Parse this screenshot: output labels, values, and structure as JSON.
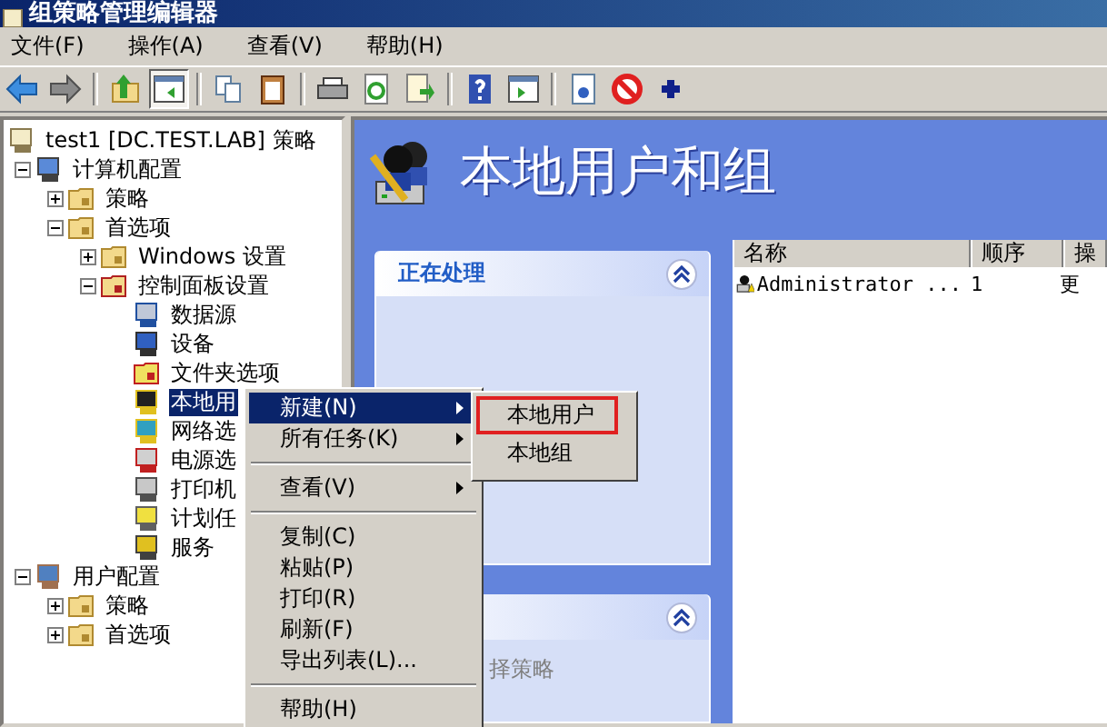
{
  "window": {
    "title": "组策略管理编辑器"
  },
  "menu_bar": [
    "文件(F)",
    "操作(A)",
    "查看(V)",
    "帮助(H)"
  ],
  "toolbar": [
    {
      "kind": "back",
      "pressed": false
    },
    {
      "kind": "forward",
      "pressed": false
    },
    {
      "kind": "separator"
    },
    {
      "kind": "up",
      "pressed": false
    },
    {
      "kind": "tree",
      "pressed": true
    },
    {
      "kind": "separator"
    },
    {
      "kind": "copy",
      "pressed": false
    },
    {
      "kind": "paste",
      "pressed": false
    },
    {
      "kind": "separator"
    },
    {
      "kind": "print",
      "pressed": false
    },
    {
      "kind": "refresh",
      "pressed": false
    },
    {
      "kind": "export",
      "pressed": false
    },
    {
      "kind": "separator"
    },
    {
      "kind": "help",
      "pressed": false
    },
    {
      "kind": "pane",
      "pressed": false
    },
    {
      "kind": "separator"
    },
    {
      "kind": "properties",
      "pressed": false
    },
    {
      "kind": "stop",
      "pressed": false
    },
    {
      "kind": "add",
      "pressed": false
    }
  ],
  "tree": {
    "label": "test1 [DC.TEST.LAB] 策略",
    "kind": "scroll",
    "selected": false,
    "children": [
      {
        "label": "计算机配置",
        "kind": "computer",
        "expanded": true,
        "selected": false,
        "children": [
          {
            "label": "策略",
            "kind": "folder",
            "expanded": false,
            "selected": false
          },
          {
            "label": "首选项",
            "kind": "folder",
            "expanded": true,
            "selected": false,
            "children": [
              {
                "label": "Windows 设置",
                "kind": "folder",
                "expanded": false,
                "selected": false
              },
              {
                "label": "控制面板设置",
                "kind": "control-panel",
                "expanded": true,
                "selected": false,
                "children": [
                  {
                    "label": "数据源",
                    "kind": "datasource",
                    "selected": false
                  },
                  {
                    "label": "设备",
                    "kind": "device",
                    "selected": false
                  },
                  {
                    "label": "文件夹选项",
                    "kind": "folder-options",
                    "selected": false
                  },
                  {
                    "label": "本地用",
                    "kind": "users",
                    "selected": true
                  },
                  {
                    "label": "网络选",
                    "kind": "network",
                    "selected": false
                  },
                  {
                    "label": "电源选",
                    "kind": "power",
                    "selected": false
                  },
                  {
                    "label": "打印机",
                    "kind": "printer",
                    "selected": false
                  },
                  {
                    "label": "计划任",
                    "kind": "task",
                    "selected": false
                  },
                  {
                    "label": "服务",
                    "kind": "service",
                    "selected": false
                  }
                ]
              }
            ]
          }
        ]
      },
      {
        "label": "用户配置",
        "kind": "user",
        "expanded": true,
        "selected": false,
        "children": [
          {
            "label": "策略",
            "kind": "folder",
            "expanded": false,
            "selected": false
          },
          {
            "label": "首选项",
            "kind": "folder",
            "expanded": false,
            "selected": false
          }
        ]
      }
    ]
  },
  "header": {
    "title": "本地用户和组"
  },
  "task_pane": [
    {
      "title": "正在处理",
      "expanded": true
    },
    {
      "text": "择策略",
      "expanded": true
    }
  ],
  "list": {
    "columns": [
      "名称",
      "顺序",
      "操"
    ],
    "rows": [
      [
        "Administrator ...",
        "1",
        "更"
      ]
    ]
  },
  "context_menu": [
    {
      "kind": "item",
      "label": "新建(N)",
      "submenu": true,
      "selected": true
    },
    {
      "kind": "item",
      "label": "所有任务(K)",
      "submenu": true,
      "selected": false
    },
    {
      "kind": "separator"
    },
    {
      "kind": "item",
      "label": "查看(V)",
      "submenu": true,
      "selected": false
    },
    {
      "kind": "separator"
    },
    {
      "kind": "item",
      "label": "复制(C)",
      "submenu": false,
      "selected": false
    },
    {
      "kind": "item",
      "label": "粘贴(P)",
      "submenu": false,
      "selected": false
    },
    {
      "kind": "item",
      "label": "打印(R)",
      "submenu": false,
      "selected": false
    },
    {
      "kind": "item",
      "label": "刷新(F)",
      "submenu": false,
      "selected": false
    },
    {
      "kind": "item",
      "label": "导出列表(L)...",
      "submenu": false,
      "selected": false
    },
    {
      "kind": "separator"
    },
    {
      "kind": "item",
      "label": "帮助(H)",
      "submenu": false,
      "selected": false
    }
  ],
  "submenu": [
    {
      "label": "本地用户",
      "highlighted": true
    },
    {
      "label": "本地组",
      "highlighted": false
    }
  ]
}
